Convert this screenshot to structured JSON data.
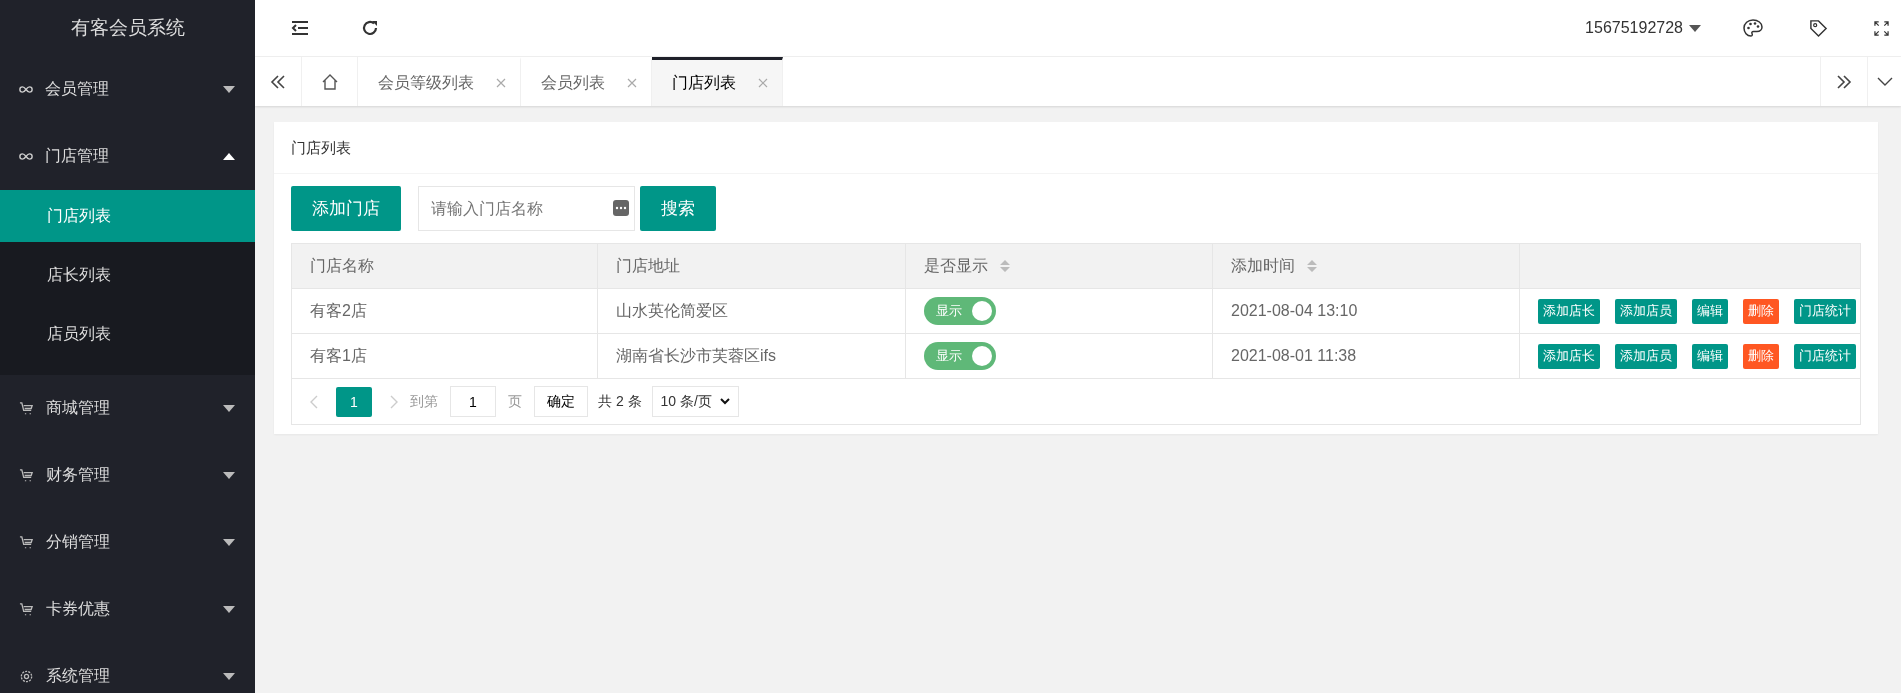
{
  "sidebar": {
    "title": "有客会员系统",
    "items": [
      {
        "label": "会员管理",
        "kind": "link",
        "expanded": false
      },
      {
        "label": "门店管理",
        "kind": "link",
        "expanded": true,
        "children": [
          {
            "label": "门店列表",
            "selected": true
          },
          {
            "label": "店长列表",
            "selected": false
          },
          {
            "label": "店员列表",
            "selected": false
          }
        ]
      },
      {
        "label": "商城管理",
        "kind": "cart",
        "expanded": false
      },
      {
        "label": "财务管理",
        "kind": "cart",
        "expanded": false
      },
      {
        "label": "分销管理",
        "kind": "cart",
        "expanded": false
      },
      {
        "label": "卡券优惠",
        "kind": "cart",
        "expanded": false
      },
      {
        "label": "系统管理",
        "kind": "gear",
        "expanded": false
      }
    ]
  },
  "header": {
    "user": "15675192728"
  },
  "tabs": [
    {
      "label": "会员等级列表",
      "selected": false
    },
    {
      "label": "会员列表",
      "selected": false
    },
    {
      "label": "门店列表",
      "selected": true
    }
  ],
  "panel": {
    "title": "门店列表",
    "add_button": "添加门店",
    "search": {
      "placeholder": "请输入门店名称"
    },
    "search_button": "搜索"
  },
  "table": {
    "columns": [
      {
        "label": "门店名称",
        "sortable": false
      },
      {
        "label": "门店地址",
        "sortable": false
      },
      {
        "label": "是否显示",
        "sortable": true
      },
      {
        "label": "添加时间",
        "sortable": true
      }
    ],
    "rows": [
      {
        "name": "有客2店",
        "address": "山水英伦简爱区",
        "shown": {
          "on": true,
          "label": "显示"
        },
        "time": "2021-08-04 13:10",
        "actions": [
          {
            "label": "添加店长",
            "kind": "primary"
          },
          {
            "label": "添加店员",
            "kind": "primary"
          },
          {
            "label": "编辑",
            "kind": "primary"
          },
          {
            "label": "删除",
            "kind": "danger"
          },
          {
            "label": "门店统计",
            "kind": "primary"
          }
        ]
      },
      {
        "name": "有客1店",
        "address": "湖南省长沙市芙蓉区ifs",
        "shown": {
          "on": true,
          "label": "显示"
        },
        "time": "2021-08-01 11:38",
        "actions": [
          {
            "label": "添加店长",
            "kind": "primary"
          },
          {
            "label": "添加店员",
            "kind": "primary"
          },
          {
            "label": "编辑",
            "kind": "primary"
          },
          {
            "label": "删除",
            "kind": "danger"
          },
          {
            "label": "门店统计",
            "kind": "primary"
          }
        ]
      }
    ]
  },
  "pagination": {
    "pages": [
      {
        "label": "1",
        "selected": true
      }
    ],
    "goto_label": "到第",
    "goto_value": "1",
    "page_unit": "页",
    "confirm": "确定",
    "total": "共 2 条",
    "page_size": "10 条/页"
  }
}
